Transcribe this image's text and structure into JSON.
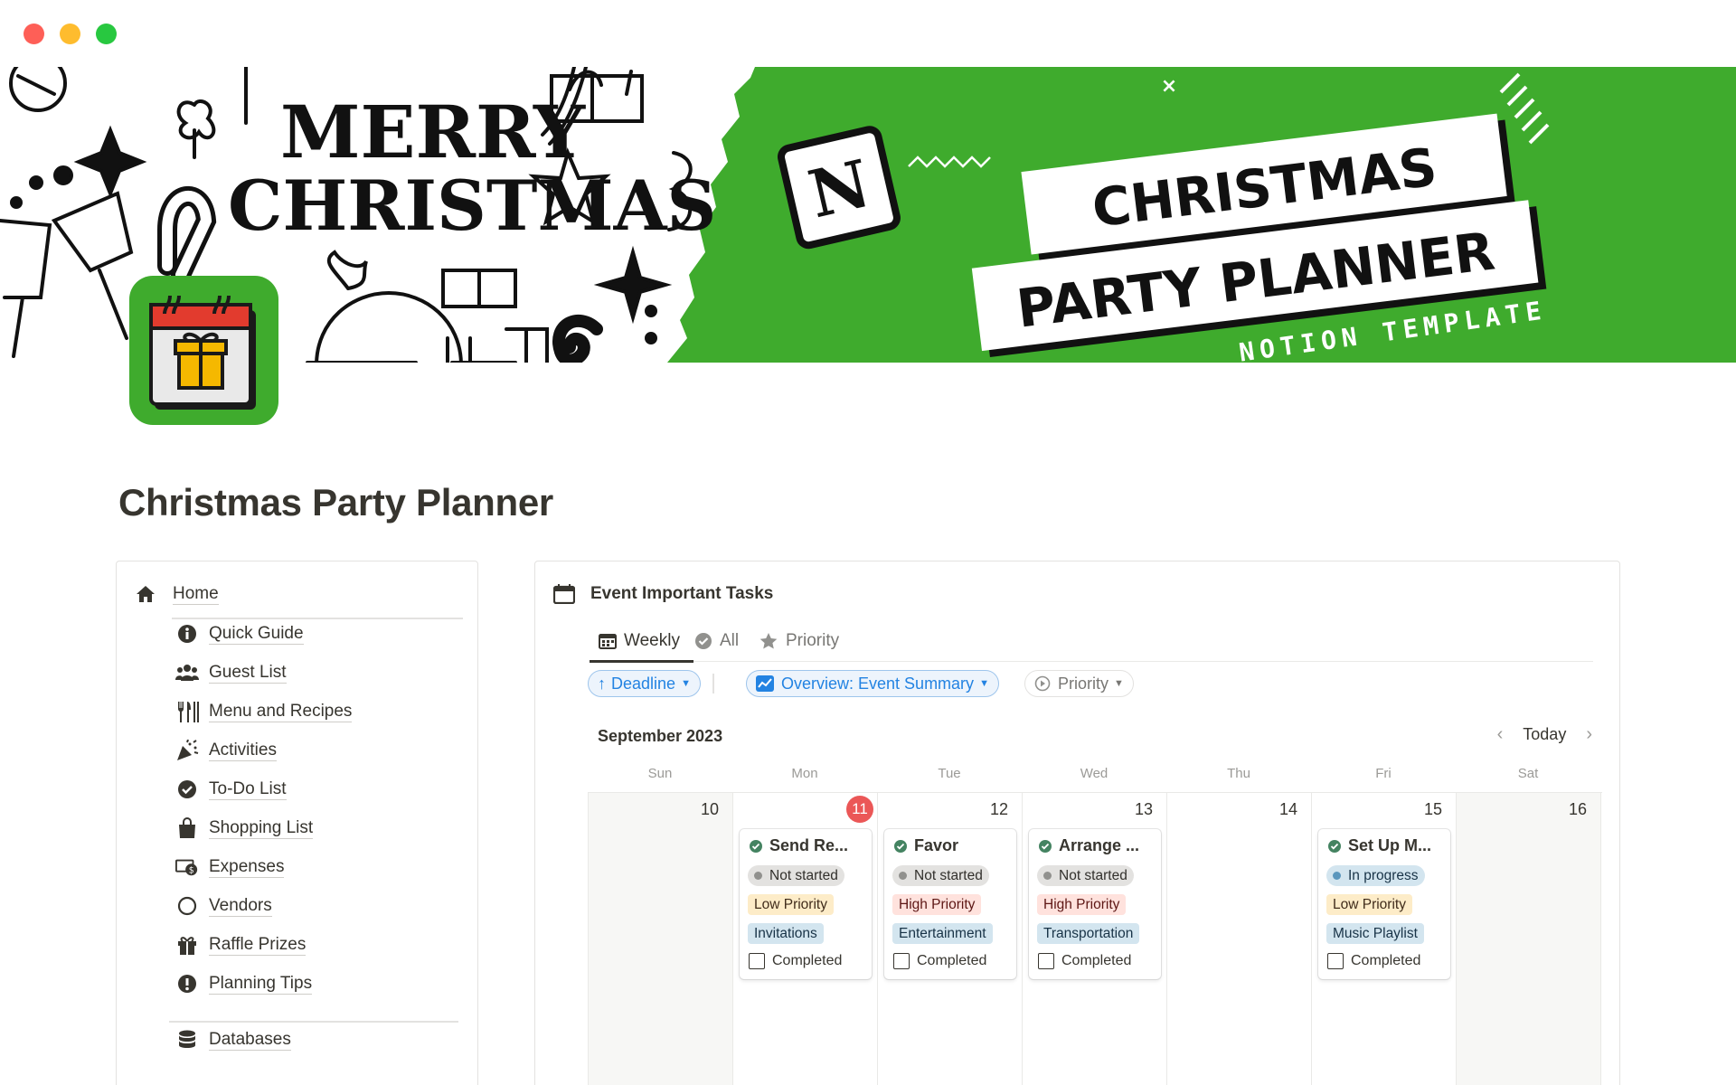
{
  "window": {
    "controls": [
      "close",
      "minimize",
      "zoom"
    ]
  },
  "banner": {
    "merry_line1": "MERRY",
    "merry_line2": "CHRISTMAS",
    "notion_letter": "N",
    "close_mark": "×",
    "title_line1": "CHRISTMAS",
    "title_line2": "PARTY PLANNER",
    "subtitle": "NOTION TEMPLATE",
    "accent_color": "#3fab2d"
  },
  "page": {
    "icon": "calendar-gift-icon",
    "title": "Christmas Party Planner"
  },
  "nav": {
    "home": {
      "label": "Home",
      "icon": "home-icon"
    },
    "items": [
      {
        "label": "Quick Guide",
        "icon": "info-icon"
      },
      {
        "label": "Guest List",
        "icon": "people-icon"
      },
      {
        "label": "Menu and Recipes",
        "icon": "utensils-icon"
      },
      {
        "label": "Activities",
        "icon": "party-popper-icon"
      },
      {
        "label": "To-Do List",
        "icon": "check-circle-icon"
      },
      {
        "label": "Shopping List",
        "icon": "shopping-bag-icon"
      },
      {
        "label": "Expenses",
        "icon": "money-icon"
      },
      {
        "label": "Vendors",
        "icon": "circle-icon"
      },
      {
        "label": "Raffle Prizes",
        "icon": "gift-icon"
      },
      {
        "label": "Planning Tips",
        "icon": "exclamation-icon"
      }
    ],
    "databases": {
      "label": "Databases",
      "icon": "database-icon"
    }
  },
  "calendar": {
    "title": "Event Important Tasks",
    "tabs": [
      {
        "label": "Weekly",
        "icon": "calendar-icon",
        "active": true
      },
      {
        "label": "All",
        "icon": "check-circle-icon",
        "active": false
      },
      {
        "label": "Priority",
        "icon": "star-icon",
        "active": false
      }
    ],
    "filters": {
      "sort": "Deadline",
      "view": "Overview: Event Summary",
      "priority": "Priority"
    },
    "month": "September 2023",
    "today_label": "Today",
    "weekdays": [
      "Sun",
      "Mon",
      "Tue",
      "Wed",
      "Thu",
      "Fri",
      "Sat"
    ],
    "days": [
      "10",
      "11",
      "12",
      "13",
      "14",
      "15",
      "16"
    ],
    "today_index": 1,
    "tasks": [
      {
        "title": "Send Re...",
        "status": "Not started",
        "priority": "Low Priority",
        "category": "Invitations",
        "done_label": "Completed"
      },
      {
        "title": "Favor",
        "status": "Not started",
        "priority": "High Priority",
        "category": "Entertainment",
        "done_label": "Completed"
      },
      {
        "title": "Arrange ...",
        "status": "Not started",
        "priority": "High Priority",
        "category": "Transportation",
        "done_label": "Completed"
      },
      {
        "title": "Set Up M...",
        "status": "In progress",
        "priority": "Low Priority",
        "category": "Music Playlist",
        "done_label": "Completed"
      }
    ]
  }
}
